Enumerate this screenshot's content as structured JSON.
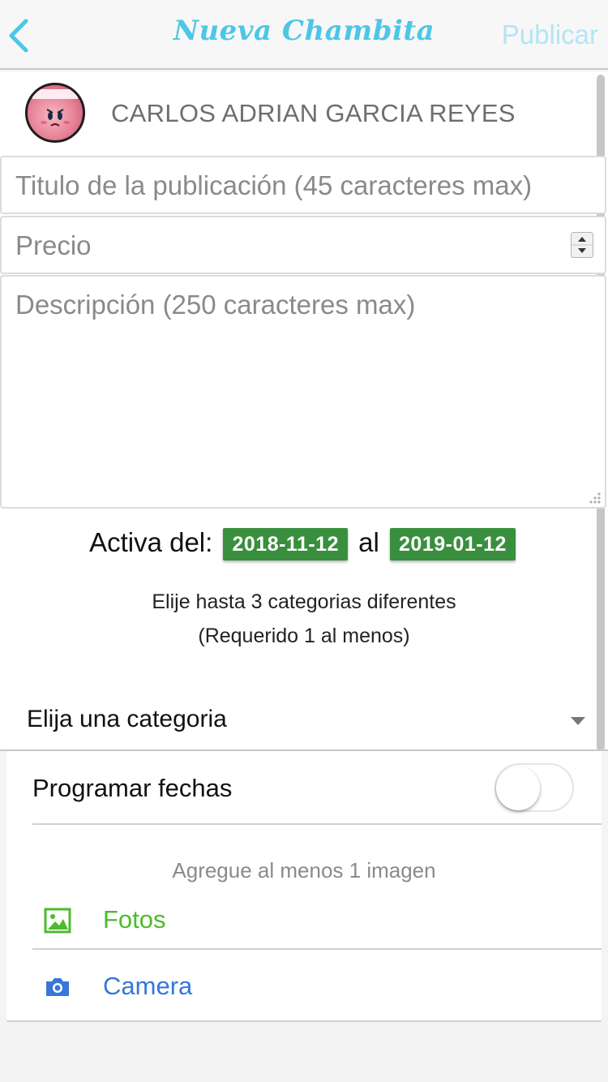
{
  "header": {
    "title": "Nueva Chambita",
    "publish_label": "Publicar",
    "back_icon": "chevron-left-icon",
    "accent_color": "#4ec6e6"
  },
  "user": {
    "name": "CARLOS ADRIAN GARCIA REYES"
  },
  "form": {
    "title_placeholder": "Titulo de la publicación (45 caracteres max)",
    "price_placeholder": "Precio",
    "description_placeholder": "Descripción (250 caracteres max)"
  },
  "dates": {
    "prefix": "Activa del:",
    "start": "2018-11-12",
    "connector": "al",
    "end": "2019-01-12",
    "chip_color": "#398f3d"
  },
  "categories": {
    "info_line1": "Elije hasta 3 categorias diferentes",
    "info_line2": "(Requerido 1 al menos)",
    "select_label": "Elija una categoria"
  },
  "schedule": {
    "label": "Programar fechas",
    "toggle_on": false
  },
  "images": {
    "hint": "Agregue al menos 1 imagen",
    "photos_label": "Fotos",
    "photos_color": "#4cbb2c",
    "camera_label": "Camera",
    "camera_color": "#3777d9"
  }
}
